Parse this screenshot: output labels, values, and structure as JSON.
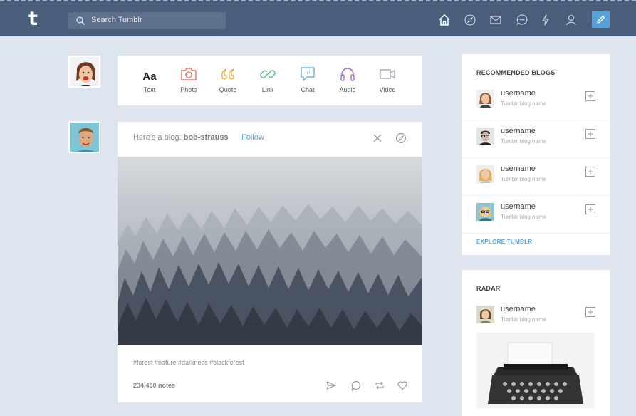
{
  "header": {
    "logo_letter": "t",
    "search_placeholder": "Search Tumblr",
    "nav_icons": [
      "home-icon",
      "compass-icon",
      "mail-icon",
      "chat-icon",
      "lightning-icon",
      "account-icon"
    ],
    "compose_icon": "pencil-icon"
  },
  "post_types": [
    {
      "label": "Text",
      "icon": "text-icon",
      "glyph": "Aa",
      "color": "#222222"
    },
    {
      "label": "Photo",
      "icon": "camera-icon",
      "color": "#e8685a"
    },
    {
      "label": "Quote",
      "icon": "quote-icon",
      "color": "#f2a93b"
    },
    {
      "label": "Link",
      "icon": "link-icon",
      "color": "#56bc8a"
    },
    {
      "label": "Chat",
      "icon": "chat-bubble-icon",
      "glyph": "hi!",
      "color": "#5aa6d6"
    },
    {
      "label": "Audio",
      "icon": "headphones-icon",
      "color": "#a26ac6"
    },
    {
      "label": "Video",
      "icon": "video-icon",
      "color": "#9aa3ad"
    }
  ],
  "post": {
    "prefix": "Here's a blog:",
    "blog": "bob-strauss",
    "follow_label": "Follow",
    "tags": "#forest #nature #darkness #blackforest",
    "notes": "234,450 notes"
  },
  "recommended": {
    "title": "RECOMMENDED BLOGS",
    "items": [
      {
        "username": "username",
        "subtitle": "Tumblr blog name"
      },
      {
        "username": "username",
        "subtitle": "Tumblr blog name"
      },
      {
        "username": "username",
        "subtitle": "Tumblr blog name"
      },
      {
        "username": "username",
        "subtitle": "Tumblr blog name"
      }
    ],
    "explore_label": "EXPLORE TUMBLR"
  },
  "radar": {
    "title": "RADAR",
    "username": "username",
    "subtitle": "Tumblr blog name"
  },
  "colors": {
    "header": "#4a5d7a",
    "background": "#dfe5ef",
    "accent": "#55a2d8"
  }
}
